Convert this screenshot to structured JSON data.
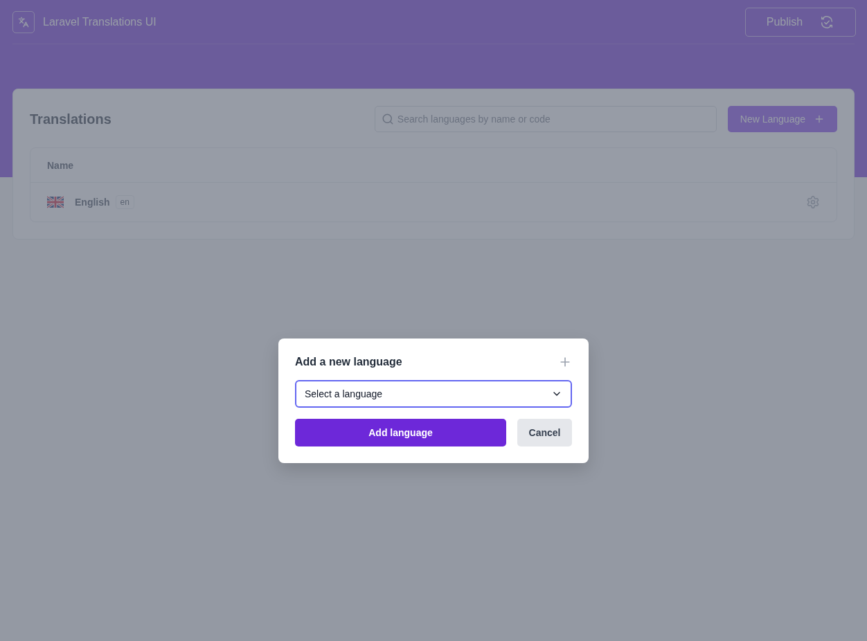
{
  "header": {
    "title": "Laravel Translations UI",
    "publish_button": "Publish"
  },
  "page": {
    "title": "Translations",
    "search": {
      "placeholder": "Search languages by name or code"
    },
    "new_button": "New Language",
    "table": {
      "columns": [
        "Name"
      ],
      "rows": [
        {
          "name": "English",
          "code": "en"
        }
      ]
    }
  },
  "modal": {
    "title": "Add a new language",
    "select": {
      "value": "Select a language"
    },
    "buttons": [
      {
        "label": "Add language",
        "kind": "primary"
      },
      {
        "label": "Cancel",
        "kind": "secondary"
      }
    ]
  }
}
